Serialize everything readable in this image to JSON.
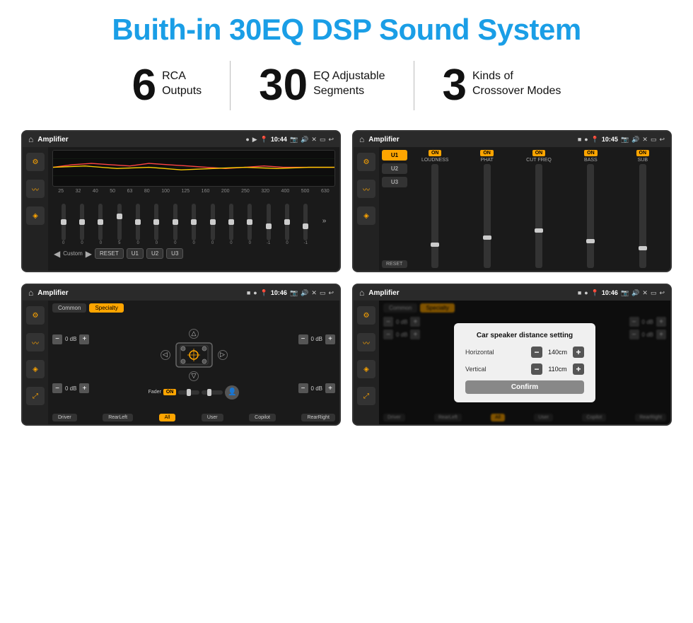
{
  "header": {
    "title": "Buith-in 30EQ DSP Sound System"
  },
  "stats": [
    {
      "number": "6",
      "label1": "RCA",
      "label2": "Outputs"
    },
    {
      "number": "30",
      "label1": "EQ Adjustable",
      "label2": "Segments"
    },
    {
      "number": "3",
      "label1": "Kinds of",
      "label2": "Crossover Modes"
    }
  ],
  "screens": [
    {
      "id": "screen1",
      "topbar": {
        "title": "Amplifier",
        "time": "10:44"
      },
      "type": "eq",
      "freqs": [
        "25",
        "32",
        "40",
        "50",
        "63",
        "80",
        "100",
        "125",
        "160",
        "200",
        "250",
        "320",
        "400",
        "500",
        "630"
      ],
      "values": [
        "0",
        "0",
        "0",
        "5",
        "0",
        "0",
        "0",
        "0",
        "0",
        "0",
        "0",
        "-1",
        "0",
        "-1"
      ],
      "preset": "Custom",
      "buttons": [
        "RESET",
        "U1",
        "U2",
        "U3"
      ]
    },
    {
      "id": "screen2",
      "topbar": {
        "title": "Amplifier",
        "time": "10:45"
      },
      "type": "amp2",
      "presets": [
        "U1",
        "U2",
        "U3"
      ],
      "controls": [
        {
          "label": "LOUDNESS",
          "on": true
        },
        {
          "label": "PHAT",
          "on": true
        },
        {
          "label": "CUT FREQ",
          "on": true
        },
        {
          "label": "BASS",
          "on": true
        },
        {
          "label": "SUB",
          "on": true
        }
      ],
      "reset_label": "RESET"
    },
    {
      "id": "screen3",
      "topbar": {
        "title": "Amplifier",
        "time": "10:46"
      },
      "type": "fader",
      "tabs": [
        "Common",
        "Specialty"
      ],
      "fader_label": "Fader",
      "fader_on": "ON",
      "db_rows": [
        "0 dB",
        "0 dB",
        "0 dB",
        "0 dB"
      ],
      "bottom_btns": [
        "Driver",
        "RearLeft",
        "All",
        "User",
        "Copilot",
        "RearRight"
      ]
    },
    {
      "id": "screen4",
      "topbar": {
        "title": "Amplifier",
        "time": "10:46"
      },
      "type": "fader_dialog",
      "tabs": [
        "Common",
        "Specialty"
      ],
      "dialog": {
        "title": "Car speaker distance setting",
        "horizontal_label": "Horizontal",
        "horizontal_value": "140cm",
        "vertical_label": "Vertical",
        "vertical_value": "110cm",
        "confirm_label": "Confirm"
      },
      "bottom_btns": [
        "Driver",
        "RearLeft",
        "All",
        "User",
        "Copilot",
        "RearRight"
      ]
    }
  ]
}
